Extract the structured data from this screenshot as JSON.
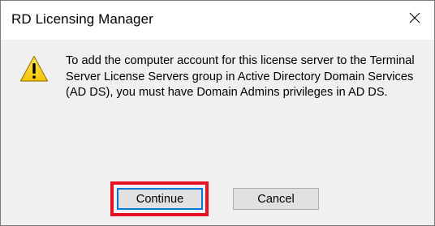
{
  "dialog": {
    "title": "RD Licensing Manager",
    "close_icon": "close-icon",
    "warning_icon": "warning-icon",
    "message": "To add the computer account for this license server to the Terminal Server License Servers group in Active Directory Domain Services (AD DS), you must have Domain Admins privileges in AD DS.",
    "buttons": {
      "continue_label": "Continue",
      "cancel_label": "Cancel"
    }
  },
  "colors": {
    "highlight": "#e81123",
    "focus_border": "#0078d7",
    "warning_fill": "#fcd116"
  }
}
